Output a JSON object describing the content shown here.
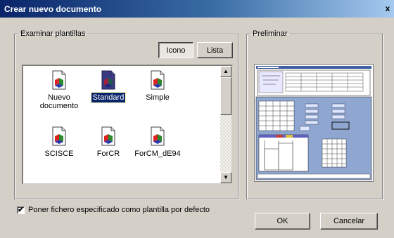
{
  "window": {
    "title": "Crear nuevo documento",
    "close_glyph": "x"
  },
  "browse": {
    "legend": "Examinar plantillas",
    "icon_button": "Icono",
    "list_button": "Lista",
    "items": [
      {
        "label_line1": "Nuevo",
        "label_line2": "documento",
        "icon": "document-template-icon",
        "selected": false
      },
      {
        "label_line1": "Standard",
        "label_line2": "",
        "icon": "document-template-icon",
        "selected": true
      },
      {
        "label_line1": "Simple",
        "label_line2": "",
        "icon": "document-template-icon",
        "selected": false
      },
      {
        "label_line1": "SCISCE",
        "label_line2": "",
        "icon": "document-template-icon",
        "selected": false
      },
      {
        "label_line1": "ForCR",
        "label_line2": "",
        "icon": "document-template-icon",
        "selected": false
      },
      {
        "label_line1": "ForCM_dE94",
        "label_line2": "",
        "icon": "document-template-icon",
        "selected": false
      }
    ]
  },
  "preview": {
    "legend": "Preliminar"
  },
  "default_checkbox": {
    "label": "Poner fichero especificado como plantilla por defecto",
    "checked": true,
    "mark": "✔"
  },
  "buttons": {
    "ok": "OK",
    "cancel": "Cancelar"
  },
  "colors": {
    "title_start": "#0a246a",
    "title_end": "#a6caf0",
    "selection": "#0a246a",
    "face": "#d4d0c8",
    "preview_bg": "#8ea6d0"
  }
}
